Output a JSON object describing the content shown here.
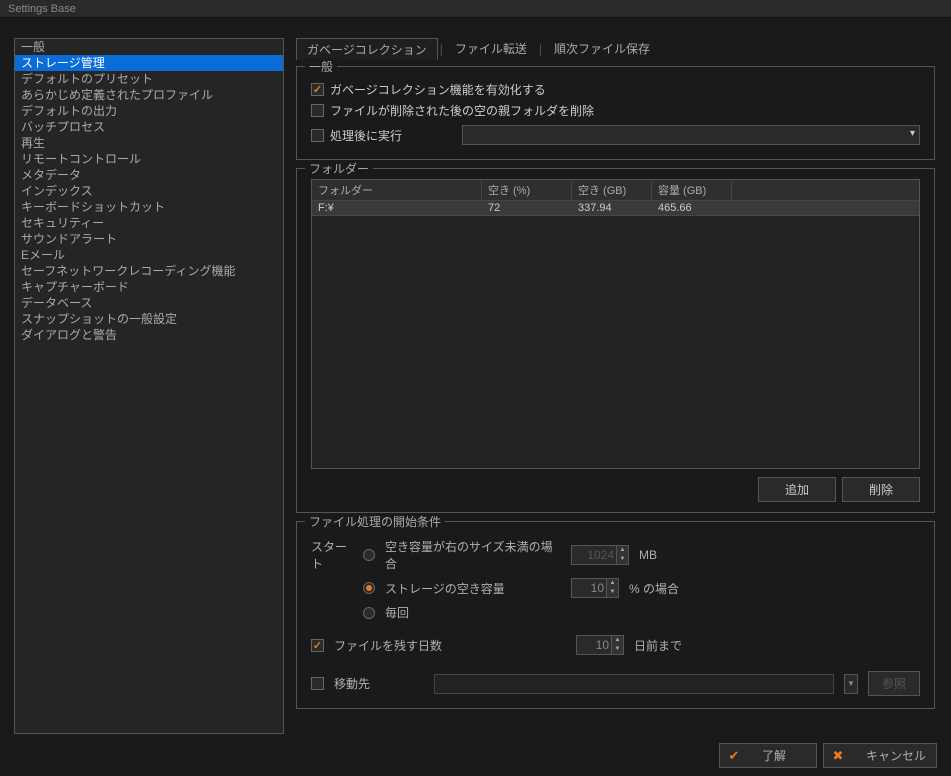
{
  "window": {
    "title": "Settings Base"
  },
  "sidebar": {
    "items": [
      {
        "label": "一般"
      },
      {
        "label": "ストレージ管理"
      },
      {
        "label": "デフォルトのプリセット"
      },
      {
        "label": "あらかじめ定義されたプロファイル"
      },
      {
        "label": "デフォルトの出力"
      },
      {
        "label": "バッチプロセス"
      },
      {
        "label": "再生"
      },
      {
        "label": "リモートコントロール"
      },
      {
        "label": "メタデータ"
      },
      {
        "label": "インデックス"
      },
      {
        "label": "キーボードショットカット"
      },
      {
        "label": "セキュリティー"
      },
      {
        "label": "サウンドアラート"
      },
      {
        "label": "Eメール"
      },
      {
        "label": "セーフネットワークレコーディング機能"
      },
      {
        "label": "キャプチャーボード"
      },
      {
        "label": "データベース"
      },
      {
        "label": "スナップショットの一般設定"
      },
      {
        "label": "ダイアログと警告"
      }
    ],
    "selected_index": 1
  },
  "tabs": {
    "items": [
      {
        "label": "ガベージコレクション"
      },
      {
        "label": "ファイル転送"
      },
      {
        "label": "順次ファイル保存"
      }
    ],
    "active_index": 0
  },
  "general_group": {
    "legend": "一般",
    "enable_gc": {
      "label": "ガベージコレクション機能を有効化する",
      "checked": true
    },
    "delete_empty_parent": {
      "label": "ファイルが削除された後の空の親フォルダを削除",
      "checked": false
    },
    "run_after": {
      "label": "処理後に実行",
      "checked": false,
      "value": ""
    }
  },
  "folder_group": {
    "legend": "フォルダー",
    "headers": {
      "folder": "フォルダー",
      "free_pct": "空き (%)",
      "free_gb": "空き (GB)",
      "cap_gb": "容量 (GB)"
    },
    "rows": [
      {
        "folder": "F:¥",
        "free_pct": "72",
        "free_gb": "337.94",
        "cap_gb": "465.66"
      }
    ],
    "buttons": {
      "add": "追加",
      "remove": "削除"
    }
  },
  "condition_group": {
    "legend": "ファイル処理の開始条件",
    "start_label": "スタート",
    "radio_size": {
      "label": "空き容量が右のサイズ未満の場合",
      "value": "1024",
      "unit": "MB"
    },
    "radio_pct": {
      "label": "ストレージの空き容量",
      "value": "10",
      "unit": "% の場合"
    },
    "radio_every": {
      "label": "毎回"
    },
    "selected_radio": "pct",
    "keep_days": {
      "label": "ファイルを残す日数",
      "checked": true,
      "value": "10",
      "unit": "日前まで"
    },
    "move_to": {
      "label": "移動先",
      "checked": false,
      "value": "",
      "browse": "参照"
    }
  },
  "footer": {
    "ok": "了解",
    "cancel": "キャンセル"
  }
}
